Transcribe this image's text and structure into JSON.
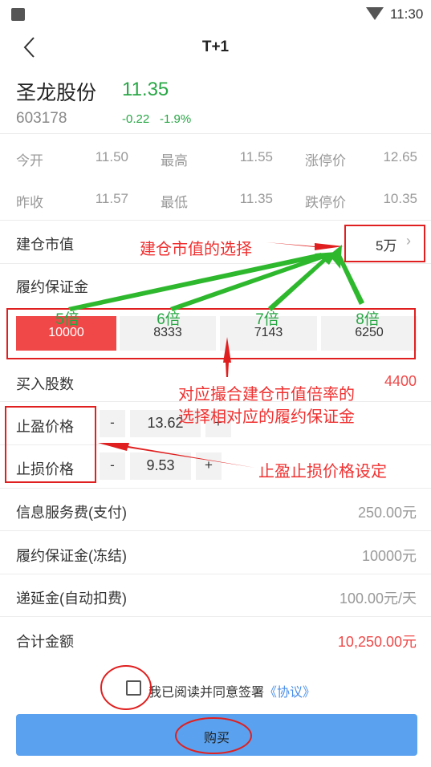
{
  "status_bar": {
    "time": "11:30"
  },
  "nav": {
    "title": "T+1"
  },
  "stock": {
    "name": "圣龙股份",
    "price": "11.35",
    "code": "603178",
    "change": "-0.22",
    "change_pct": "-1.9%"
  },
  "quote": {
    "open_label": "今开",
    "open": "11.50",
    "high_label": "最高",
    "high": "11.55",
    "limit_up_label": "涨停价",
    "limit_up": "12.65",
    "prev_close_label": "昨收",
    "prev_close": "11.57",
    "low_label": "最低",
    "low": "11.35",
    "limit_down_label": "跌停价",
    "limit_down": "10.35"
  },
  "position": {
    "label": "建仓市值",
    "value": "5万"
  },
  "margin": {
    "label": "履约保证金",
    "options": [
      {
        "multiplier": "5倍",
        "amount": "10000",
        "selected": true
      },
      {
        "multiplier": "6倍",
        "amount": "8333",
        "selected": false
      },
      {
        "multiplier": "7倍",
        "amount": "7143",
        "selected": false
      },
      {
        "multiplier": "8倍",
        "amount": "6250",
        "selected": false
      }
    ]
  },
  "shares": {
    "label": "买入股数",
    "value": "4400"
  },
  "take_profit": {
    "label": "止盈价格",
    "value": "13.62",
    "minus": "-",
    "plus": "+"
  },
  "stop_loss": {
    "label": "止损价格",
    "value": "9.53",
    "minus": "-",
    "plus": "+"
  },
  "fees": [
    {
      "label": "信息服务费(支付)",
      "value": "250.00元"
    },
    {
      "label": "履约保证金(冻结)",
      "value": "10000元"
    },
    {
      "label": "递延金(自动扣费)",
      "value": "100.00元/天"
    }
  ],
  "total": {
    "label": "合计金额",
    "value": "10,250.00元"
  },
  "agreement": {
    "text": "我已阅读并同意签署",
    "link": "《协议》",
    "checked": false
  },
  "buy_button": {
    "label": "购买"
  },
  "annotations": {
    "position_note": "建仓市值的选择",
    "margin_note_line1": "对应撮合建仓市值倍率的",
    "margin_note_line2": "选择相对应的履约保证金",
    "price_note": "止盈止损价格设定"
  },
  "colors": {
    "green": "#28a745",
    "red": "#f04848",
    "blue": "#5aa2ef",
    "annotation_red": "#e02020",
    "annotation_green": "#2eb82e"
  }
}
